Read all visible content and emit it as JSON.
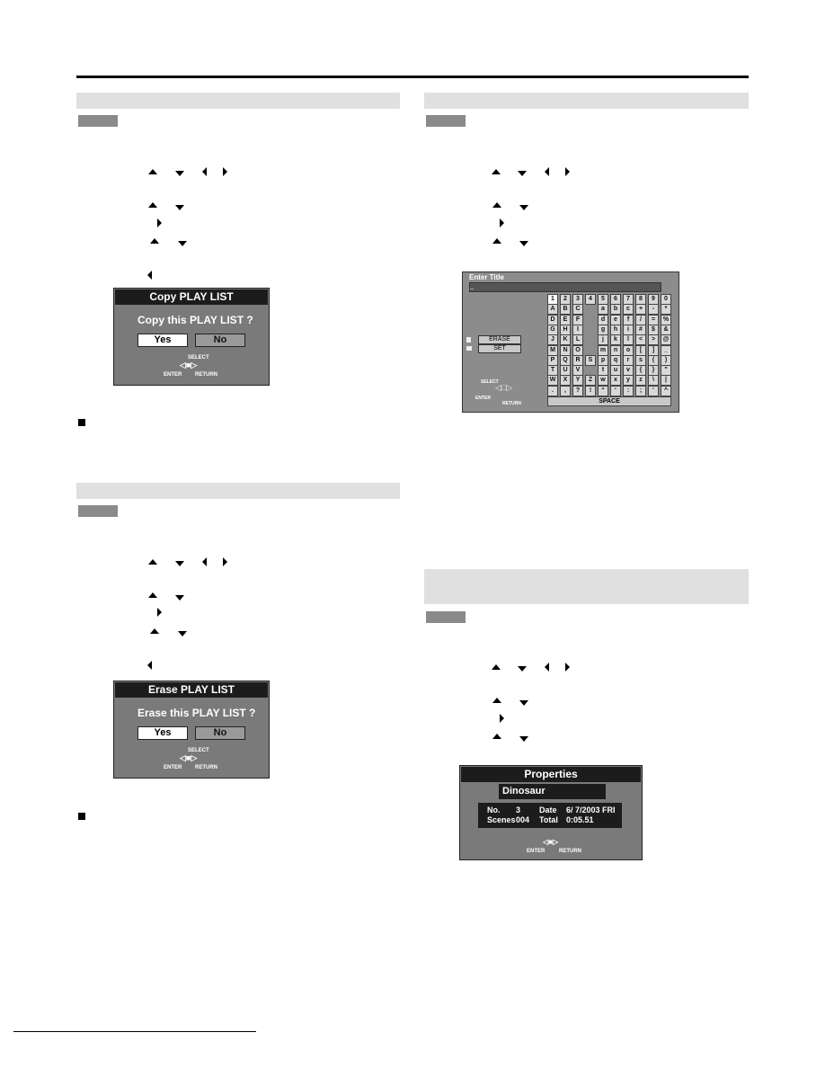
{
  "copy_dialog": {
    "title": "Copy PLAY LIST",
    "question": "Copy this PLAY LIST ?",
    "yes": "Yes",
    "no": "No",
    "select": "SELECT",
    "enter": "ENTER",
    "return": "RETURN"
  },
  "erase_dialog": {
    "title": "Erase PLAY LIST",
    "question": "Erase this PLAY LIST ?",
    "yes": "Yes",
    "no": "No",
    "select": "SELECT",
    "enter": "ENTER",
    "return": "RETURN"
  },
  "enter_title": {
    "title": "Enter Title",
    "input_value": "_",
    "erase": "ERASE",
    "set": "SET",
    "space": "SPACE",
    "select": "SELECT",
    "enter": "ENTER",
    "return": "RETURN",
    "keys": [
      [
        "1",
        "2",
        "3",
        "4",
        "5",
        "6",
        "7",
        "8",
        "9",
        "0"
      ],
      [
        "A",
        "B",
        "C",
        "",
        "a",
        "b",
        "c",
        "+",
        "-",
        "*"
      ],
      [
        "D",
        "E",
        "F",
        "",
        "d",
        "e",
        "f",
        "/",
        "=",
        "%"
      ],
      [
        "G",
        "H",
        "I",
        "",
        "g",
        "h",
        "i",
        "#",
        "$",
        "&"
      ],
      [
        "J",
        "K",
        "L",
        "",
        "j",
        "k",
        "l",
        "<",
        ">",
        "@"
      ],
      [
        "M",
        "N",
        "O",
        "",
        "m",
        "n",
        "o",
        "[",
        "]",
        "_"
      ],
      [
        "P",
        "Q",
        "R",
        "S",
        "p",
        "q",
        "r",
        "s",
        "(",
        ")"
      ],
      [
        "T",
        "U",
        "V",
        "",
        "t",
        "u",
        "v",
        "{",
        "}",
        "\""
      ],
      [
        "W",
        "X",
        "Y",
        "Z",
        "w",
        "x",
        "y",
        "z",
        "\\",
        "|"
      ],
      [
        ".",
        ",",
        "?",
        "!",
        "“",
        "‘",
        ":",
        ";",
        "'",
        "^"
      ]
    ]
  },
  "properties": {
    "title": "Properties",
    "name": "Dinosaur",
    "no_label": "No.",
    "no_value": "3",
    "date_label": "Date",
    "date_value": "6/ 7/2003 FRI",
    "scenes_label": "Scenes",
    "scenes_value": "004",
    "total_label": "Total",
    "total_value": "0:05.51",
    "enter": "ENTER",
    "return": "RETURN"
  }
}
